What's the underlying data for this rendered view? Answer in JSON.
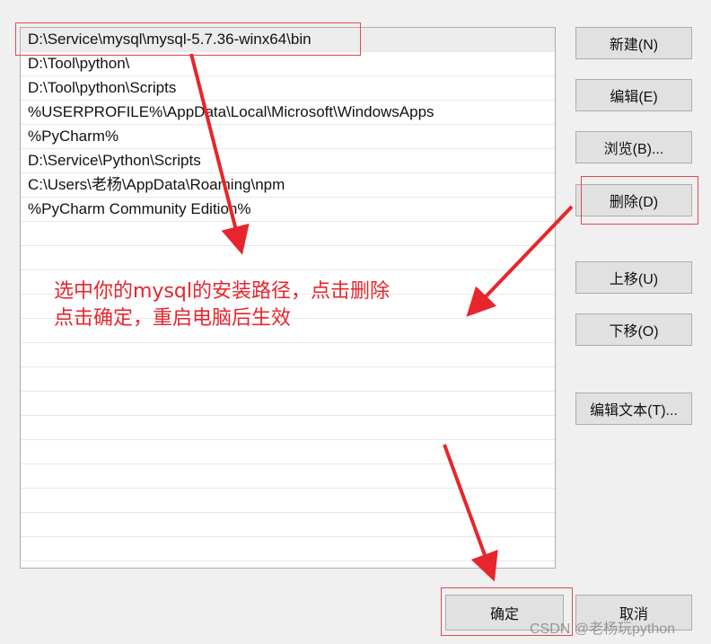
{
  "paths": [
    "D:\\Service\\mysql\\mysql-5.7.36-winx64\\bin",
    "D:\\Tool\\python\\",
    "D:\\Tool\\python\\Scripts",
    "%USERPROFILE%\\AppData\\Local\\Microsoft\\WindowsApps",
    "%PyCharm%",
    "D:\\Service\\Python\\Scripts",
    "C:\\Users\\老杨\\AppData\\Roaming\\npm",
    "%PyCharm Community Edition%",
    "",
    "",
    "",
    "",
    "",
    "",
    "",
    "",
    "",
    "",
    "",
    "",
    "",
    ""
  ],
  "buttons": {
    "new": "新建(N)",
    "edit": "编辑(E)",
    "browse": "浏览(B)...",
    "delete": "删除(D)",
    "up": "上移(U)",
    "down": "下移(O)",
    "edit_text": "编辑文本(T)...",
    "ok": "确定",
    "cancel": "取消"
  },
  "annotation": {
    "line1": "选中你的mysql的安装路径，点击删除",
    "line2": "点击确定，重启电脑后生效",
    "color": "#e8252c"
  },
  "watermark": "CSDN @老杨玩python"
}
